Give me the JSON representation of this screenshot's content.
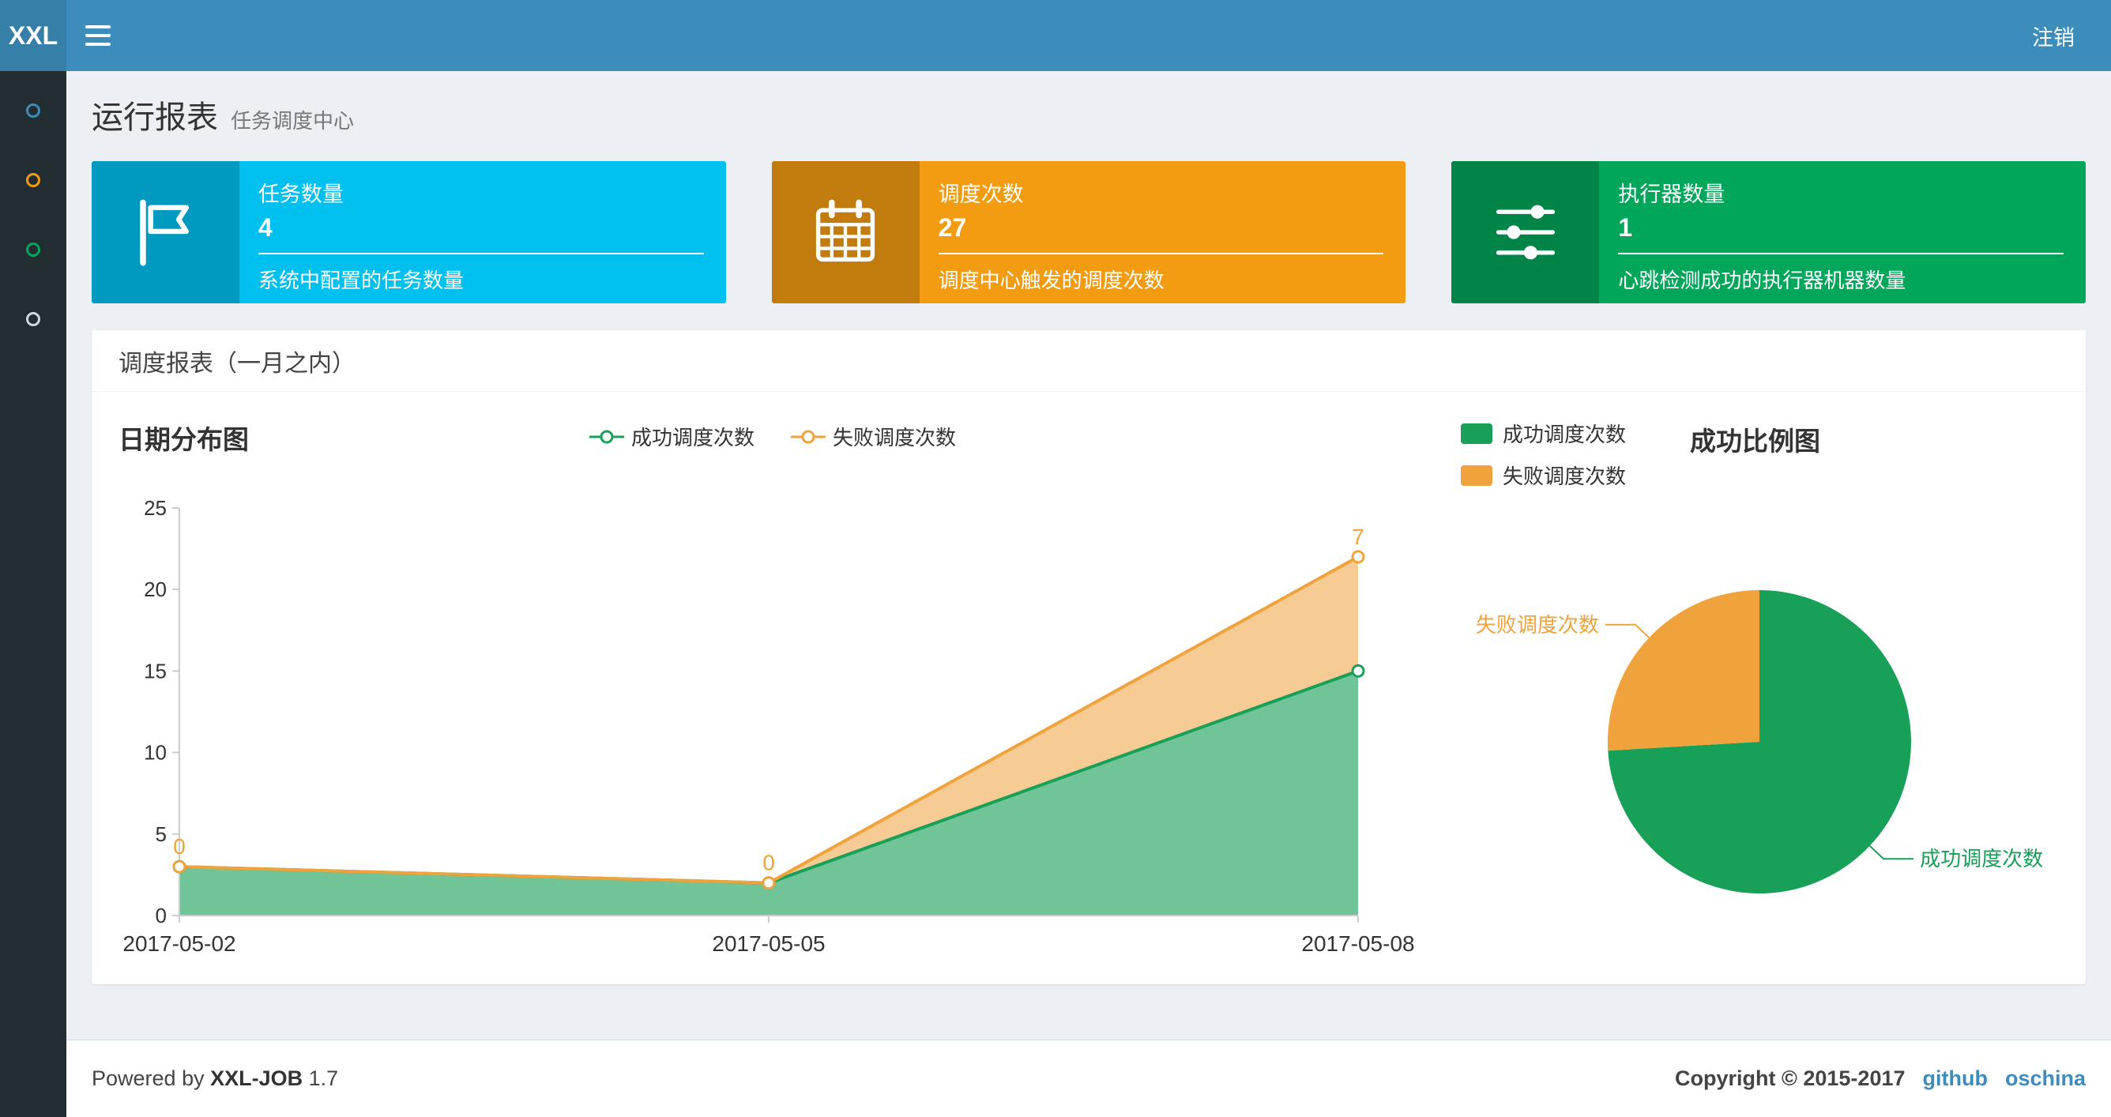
{
  "topbar": {
    "logo": "XXL",
    "logout_label": "注销"
  },
  "sidebar": {
    "items": [
      {
        "icon": "circle-icon",
        "color": "#3c8dbc"
      },
      {
        "icon": "circle-icon",
        "color": "#f39c12"
      },
      {
        "icon": "circle-icon",
        "color": "#00a65a"
      },
      {
        "icon": "circle-icon",
        "color": "#d2d6de"
      }
    ]
  },
  "page": {
    "title": "运行报表",
    "subtitle": "任务调度中心"
  },
  "info_boxes": [
    {
      "icon": "flag-icon",
      "label": "任务数量",
      "value": "4",
      "desc": "系统中配置的任务数量",
      "color": "#00c0ef"
    },
    {
      "icon": "calendar-icon",
      "label": "调度次数",
      "value": "27",
      "desc": "调度中心触发的调度次数",
      "color": "#f39c12"
    },
    {
      "icon": "sliders-icon",
      "label": "执行器数量",
      "value": "1",
      "desc": "心跳检测成功的执行器机器数量",
      "color": "#00a65a"
    }
  ],
  "panel": {
    "title": "调度报表（一月之内）"
  },
  "chart_data": [
    {
      "type": "area",
      "title": "日期分布图",
      "stacked": true,
      "categories": [
        "2017-05-02",
        "2017-05-05",
        "2017-05-08"
      ],
      "series": [
        {
          "name": "成功调度次数",
          "color": "#18a058",
          "values": [
            3,
            2,
            15
          ]
        },
        {
          "name": "失败调度次数",
          "color": "#f0a33c",
          "values": [
            0,
            0,
            7
          ],
          "data_labels": [
            "0",
            "0",
            "7"
          ]
        }
      ],
      "ylim": [
        0,
        25
      ],
      "y_ticks": [
        0,
        5,
        10,
        15,
        20,
        25
      ],
      "grid": false,
      "legend_position": "top-center"
    },
    {
      "type": "pie",
      "title": "成功比例图",
      "slices": [
        {
          "name": "成功调度次数",
          "value": 20,
          "color": "#18a058"
        },
        {
          "name": "失败调度次数",
          "value": 7,
          "color": "#f0a33c"
        }
      ],
      "legend_position": "top-left"
    }
  ],
  "footer": {
    "powered_prefix": "Powered by",
    "product": "XXL-JOB",
    "version": "1.7",
    "copyright": "Copyright © 2015-2017",
    "links": [
      {
        "label": "github"
      },
      {
        "label": "oschina"
      }
    ]
  }
}
